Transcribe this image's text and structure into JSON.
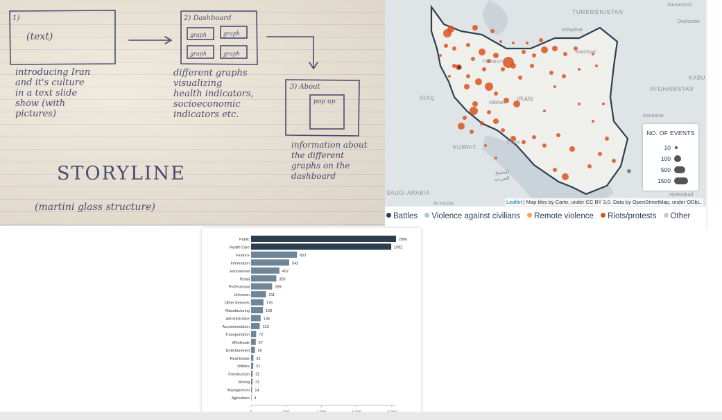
{
  "sketch": {
    "slide1": {
      "number": "1)",
      "inner": "(text)",
      "caption": "introducing Iran\nand it's culture\nin a text slide\nshow (with\npictures)"
    },
    "slide2": {
      "title": "2) Dashboard",
      "graph_label": "graph",
      "caption": "different graphs\nvisualizing\nhealth indicators,\nsocioeconomic\nindicators etc."
    },
    "slide3": {
      "title": "3) About",
      "inner": "pop up",
      "caption": "information about\nthe different\ngraphs on the\ndashboard"
    },
    "storyline": "STORYLINE",
    "structure": "(martini glass structure)"
  },
  "map": {
    "labels": {
      "turkmenistan": "TURKMENISTAN",
      "samarkand": "Samarkand",
      "dushanbe": "Dushanbe",
      "ashgabat": "Ashgabat",
      "mashhad": "Mashhad",
      "tehran": "TEHRAN",
      "iraq": "IRAQ",
      "iran": "IRAN",
      "isfahan": "Isfahan",
      "kabul": "KABU",
      "afghanistan": "AFGHANISTAN",
      "kuwait": "KUWAIT",
      "shiraz": "Shiraz",
      "gulf_ar": "الخليج\nالعربي",
      "saudi": "SAUDI ARABIA",
      "riyadh": "RIYADH",
      "kandahar": "Kandahar",
      "hyderabad": "Hyderabad"
    },
    "legend": {
      "title": "NO. OF EVENTS",
      "sizes": [
        {
          "label": "10",
          "value": 10
        },
        {
          "label": "100",
          "value": 100
        },
        {
          "label": "500",
          "value": 500
        },
        {
          "label": "1500",
          "value": 1500
        }
      ]
    },
    "attribution": {
      "link": "Leaflet",
      "text": " | Map tiles by Carto, under CC BY 3.0. Data by OpenStreetMap, under ODbL."
    },
    "categories": [
      {
        "label": "Battles",
        "color": "#2c3e50"
      },
      {
        "label": "Violence against civilians",
        "color": "#a6c8e0"
      },
      {
        "label": "Remote violence",
        "color": "#f5a35c"
      },
      {
        "label": "Riots/protests",
        "color": "#d9531e"
      },
      {
        "label": "Other",
        "color": "#c7c7c7"
      }
    ]
  },
  "chart_data": {
    "type": "bar",
    "orientation": "horizontal",
    "categories": [
      "Public",
      "Health Care",
      "Finance",
      "Information",
      "Educational",
      "Retail",
      "Professional",
      "Unknown",
      "Other Services",
      "Manufacturing",
      "Administrative",
      "Accommodation",
      "Transportation",
      "Wholesale",
      "Entertainment",
      "Real Estate",
      "Utilities",
      "Construction",
      "Mining",
      "Management",
      "Agriculture"
    ],
    "values": [
      2060,
      1992,
      653,
      542,
      402,
      359,
      299,
      211,
      176,
      168,
      136,
      123,
      72,
      67,
      55,
      33,
      31,
      22,
      21,
      14,
      4
    ],
    "value_labels": [
      "2060",
      "1992",
      "653",
      "542",
      "402",
      "359",
      "299",
      "211",
      "176",
      "168",
      "136",
      "123",
      "72",
      "67",
      "55",
      "33",
      "31",
      "22",
      "21",
      "14",
      "4"
    ],
    "xlim": [
      0,
      2060
    ],
    "xticks": [
      0,
      500,
      1000,
      1500,
      2000
    ],
    "xtick_labels": [
      "0",
      "500",
      "1,000",
      "1,500",
      "2,000"
    ],
    "colors": {
      "top": "#2d3e4e",
      "rest": "#6f8598"
    },
    "title": "",
    "xlabel": "",
    "ylabel": ""
  }
}
